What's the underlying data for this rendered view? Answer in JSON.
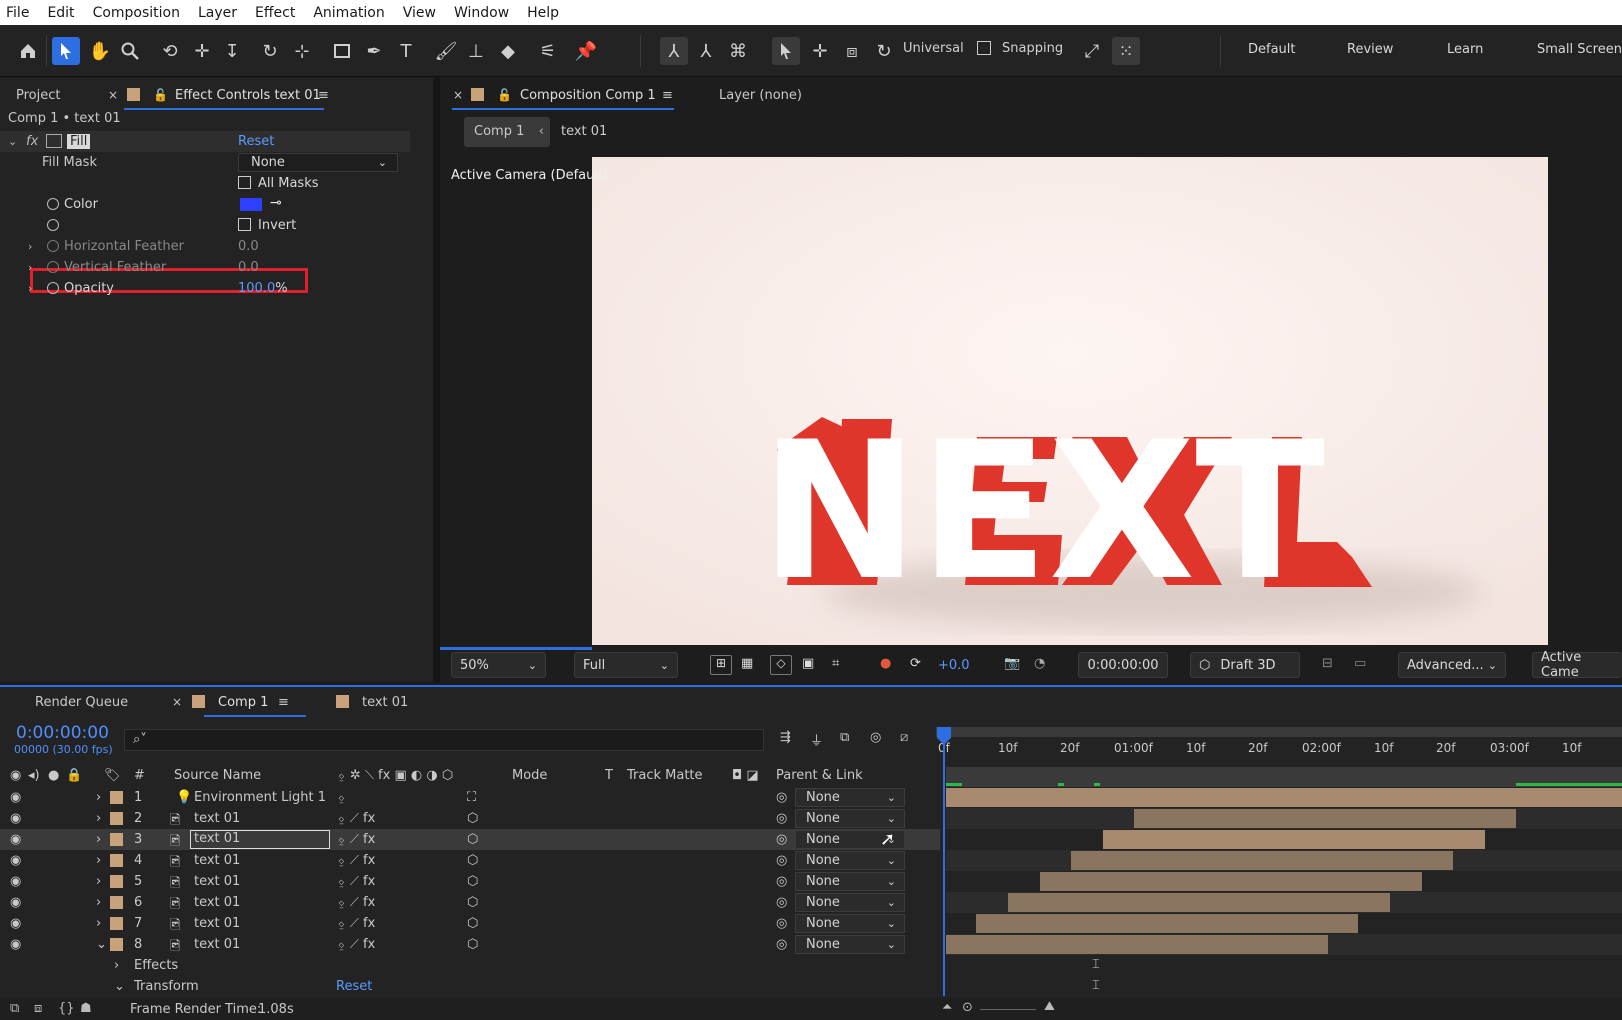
{
  "menu": [
    "File",
    "Edit",
    "Composition",
    "Layer",
    "Effect",
    "Animation",
    "View",
    "Window",
    "Help"
  ],
  "toolbar": {
    "universal_label": "Universal",
    "snapping_label": "Snapping",
    "workspaces": [
      "Default",
      "Review",
      "Learn",
      "Small Screen"
    ]
  },
  "left_panel": {
    "project_tab": "Project",
    "effect_controls_tab": "Effect Controls text 01",
    "breadcrumb": "Comp 1 • text 01",
    "effect_name": "Fill",
    "reset_label": "Reset",
    "fill_mask_label": "Fill Mask",
    "fill_mask_value": "None",
    "all_masks_label": "All Masks",
    "color_label": "Color",
    "color_value": "#2f3fff",
    "invert_label": "Invert",
    "h_feather_label": "Horizontal Feather",
    "h_feather_value": "0.0",
    "v_feather_label": "Vertical Feather",
    "v_feather_value": "0.0",
    "opacity_label": "Opacity",
    "opacity_value": "100.0",
    "opacity_unit": "%"
  },
  "comp_panel": {
    "tab_label": "Composition Comp 1",
    "layer_tab": "Layer (none)",
    "crumb_comp": "Comp 1",
    "crumb_layer": "text 01",
    "camera_label": "Active Camera (Default)",
    "scene_text": "NEXT",
    "zoom": "50%",
    "resolution": "Full",
    "exposure": "+0.0",
    "timecode": "0:00:00:00",
    "renderer": "Draft 3D",
    "advanced": "Advanced...",
    "active_camera_short": "Active Came"
  },
  "timeline": {
    "render_queue_tab": "Render Queue",
    "comp_tab": "Comp 1",
    "text_tab": "text 01",
    "timecode": "0:00:00:00",
    "frames_fps": "00000 (30.00 fps)",
    "columns": {
      "num": "#",
      "source": "Source Name",
      "mode": "Mode",
      "t": "T",
      "track_matte": "Track Matte",
      "parent": "Parent & Link"
    },
    "ruler_labels": [
      "0f",
      "10f",
      "20f",
      "01:00f",
      "10f",
      "20f",
      "02:00f",
      "10f",
      "20f",
      "03:00f",
      "10f"
    ],
    "layers": [
      {
        "num": "1",
        "name": "Environment Light 1",
        "parent": "None"
      },
      {
        "num": "2",
        "name": "text 01",
        "parent": "None"
      },
      {
        "num": "3",
        "name": "text 01",
        "parent": "None"
      },
      {
        "num": "4",
        "name": "text 01",
        "parent": "None"
      },
      {
        "num": "5",
        "name": "text 01",
        "parent": "None"
      },
      {
        "num": "6",
        "name": "text 01",
        "parent": "None"
      },
      {
        "num": "7",
        "name": "text 01",
        "parent": "None"
      },
      {
        "num": "8",
        "name": "text 01",
        "parent": "None"
      }
    ],
    "effects_label": "Effects",
    "transform_label": "Transform",
    "transform_reset": "Reset",
    "frame_render_label": "Frame Render Time:",
    "frame_render_value": "1.08s"
  }
}
